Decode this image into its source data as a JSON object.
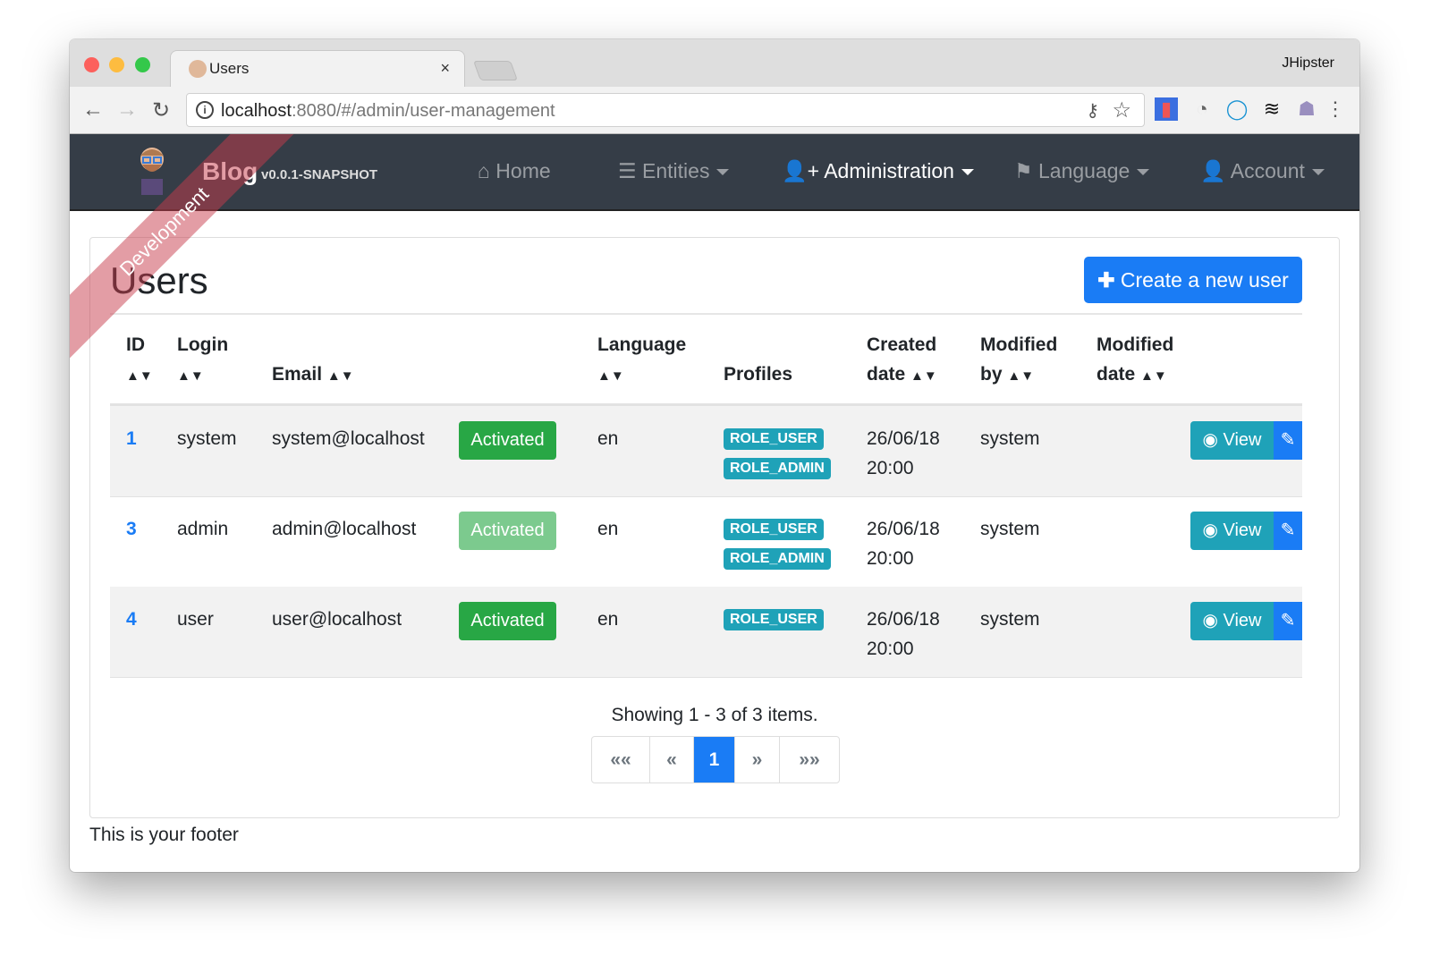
{
  "browser": {
    "tab_title": "Users",
    "profile_name": "JHipster",
    "url_host": "localhost",
    "url_rest": ":8080/#/admin/user-management"
  },
  "navbar": {
    "brand": "Blog",
    "version": "v0.0.1-SNAPSHOT",
    "ribbon": "Development",
    "items": [
      {
        "label": "Home",
        "icon": "home-icon"
      },
      {
        "label": "Entities",
        "icon": "list-icon"
      },
      {
        "label": "Administration",
        "icon": "user-plus-icon"
      },
      {
        "label": "Language",
        "icon": "flag-icon"
      },
      {
        "label": "Account",
        "icon": "user-icon"
      }
    ]
  },
  "page": {
    "title": "Users",
    "create_label": "Create a new user"
  },
  "table": {
    "headers": {
      "id": "ID",
      "login": "Login",
      "email": "Email",
      "language": "Language",
      "profiles": "Profiles",
      "created1": "Created",
      "created2": "date",
      "modby1": "Modified",
      "modby2": "by",
      "moddate1": "Modified",
      "moddate2": "date"
    },
    "rows": [
      {
        "id": "1",
        "login": "system",
        "email": "system@localhost",
        "status": "Activated",
        "language": "en",
        "roles": [
          "ROLE_USER",
          "ROLE_ADMIN"
        ],
        "created_date": "26/06/18",
        "created_time": "20:00",
        "modified_by": "system",
        "view": "View"
      },
      {
        "id": "3",
        "login": "admin",
        "email": "admin@localhost",
        "status": "Activated",
        "language": "en",
        "roles": [
          "ROLE_USER",
          "ROLE_ADMIN"
        ],
        "created_date": "26/06/18",
        "created_time": "20:00",
        "modified_by": "system",
        "view": "View"
      },
      {
        "id": "4",
        "login": "user",
        "email": "user@localhost",
        "status": "Activated",
        "language": "en",
        "roles": [
          "ROLE_USER"
        ],
        "created_date": "26/06/18",
        "created_time": "20:00",
        "modified_by": "system",
        "view": "View"
      }
    ]
  },
  "pagination": {
    "summary": "Showing 1 - 3 of 3 items.",
    "first": "««",
    "prev": "«",
    "current": "1",
    "next": "»",
    "last": "»»"
  },
  "footer": {
    "text": "This is your footer"
  },
  "colors": {
    "primary": "#1a7cf5",
    "success": "#28a745",
    "info": "#1fa2b8",
    "navbar": "#353d47"
  }
}
